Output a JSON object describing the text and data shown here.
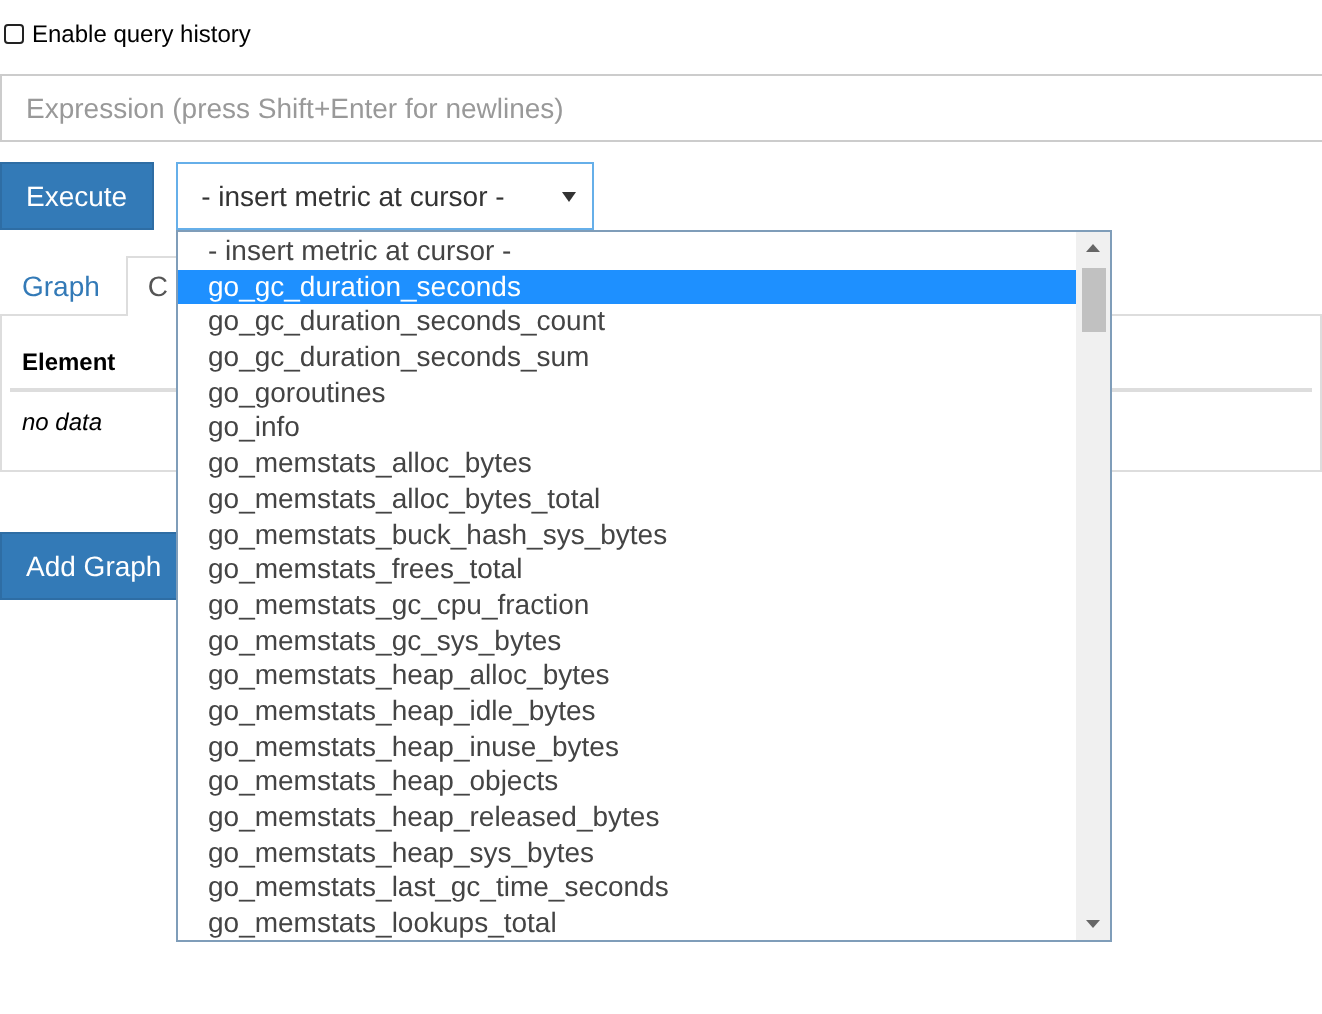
{
  "query_history": {
    "label": "Enable query history",
    "checked": false
  },
  "expression": {
    "placeholder": "Expression (press Shift+Enter for newlines)"
  },
  "execute_button": "Execute",
  "metric_select": {
    "value": "- insert metric at cursor -",
    "expanded": true,
    "options": [
      {
        "label": "- insert metric at cursor -",
        "highlighted": false
      },
      {
        "label": "go_gc_duration_seconds",
        "highlighted": true
      },
      {
        "label": "go_gc_duration_seconds_count",
        "highlighted": false
      },
      {
        "label": "go_gc_duration_seconds_sum",
        "highlighted": false
      },
      {
        "label": "go_goroutines",
        "highlighted": false
      },
      {
        "label": "go_info",
        "highlighted": false
      },
      {
        "label": "go_memstats_alloc_bytes",
        "highlighted": false
      },
      {
        "label": "go_memstats_alloc_bytes_total",
        "highlighted": false
      },
      {
        "label": "go_memstats_buck_hash_sys_bytes",
        "highlighted": false
      },
      {
        "label": "go_memstats_frees_total",
        "highlighted": false
      },
      {
        "label": "go_memstats_gc_cpu_fraction",
        "highlighted": false
      },
      {
        "label": "go_memstats_gc_sys_bytes",
        "highlighted": false
      },
      {
        "label": "go_memstats_heap_alloc_bytes",
        "highlighted": false
      },
      {
        "label": "go_memstats_heap_idle_bytes",
        "highlighted": false
      },
      {
        "label": "go_memstats_heap_inuse_bytes",
        "highlighted": false
      },
      {
        "label": "go_memstats_heap_objects",
        "highlighted": false
      },
      {
        "label": "go_memstats_heap_released_bytes",
        "highlighted": false
      },
      {
        "label": "go_memstats_heap_sys_bytes",
        "highlighted": false
      },
      {
        "label": "go_memstats_last_gc_time_seconds",
        "highlighted": false
      },
      {
        "label": "go_memstats_lookups_total",
        "highlighted": false
      }
    ]
  },
  "tabs": [
    {
      "label": "Graph",
      "selected": false
    },
    {
      "label": "C",
      "selected": true
    }
  ],
  "table": {
    "columns": [
      "Element"
    ],
    "empty_text": "no data"
  },
  "add_graph_button": "Add Graph"
}
